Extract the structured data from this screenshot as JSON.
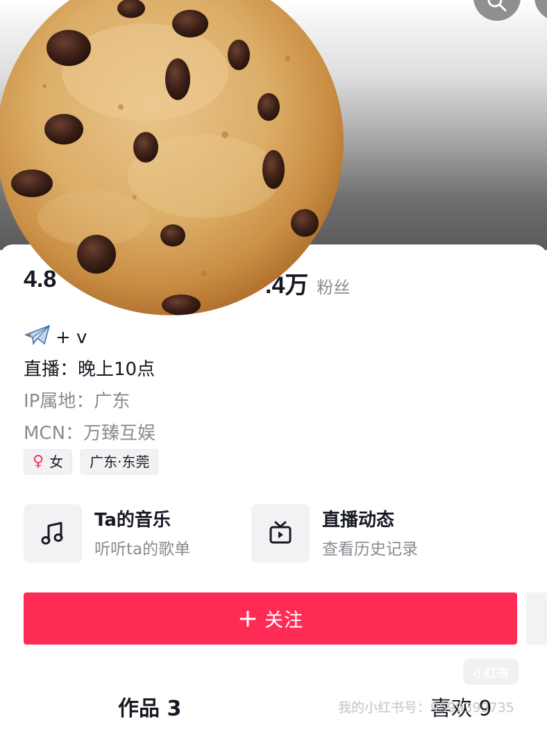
{
  "stats": {
    "likes_value": "4.8",
    "fans_value": ".4万",
    "fans_label": "粉丝"
  },
  "bio": {
    "line1": "+ v",
    "line2": "直播：晚上10点",
    "line3": "IP属地：广东",
    "line4": "MCN：万臻互娱"
  },
  "tags": {
    "gender": "女",
    "location": "广东·东莞"
  },
  "features": [
    {
      "title": "Ta的音乐",
      "sub": "听听ta的歌单",
      "icon": "music-note-icon"
    },
    {
      "title": "直播动态",
      "sub": "查看历史记录",
      "icon": "tv-icon"
    }
  ],
  "follow_button": {
    "label": "关注",
    "plus": "+"
  },
  "tabs": {
    "works": "作品 3",
    "likes": "喜欢 9"
  },
  "watermark": {
    "logo": "小红书",
    "id": "我的小红书号：9599399735"
  },
  "colors": {
    "accent": "#fe2c55",
    "text_primary": "#161823",
    "text_secondary": "#8a8b91"
  }
}
